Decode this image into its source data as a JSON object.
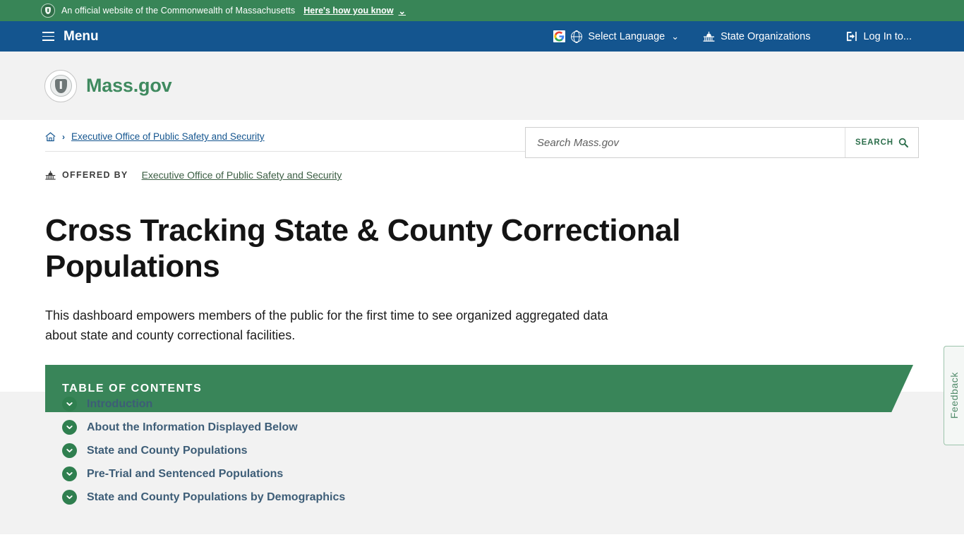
{
  "official_bar": {
    "seal_icon": "mass-seal-icon",
    "text": "An official website of the Commonwealth of Massachusetts",
    "how_you_know_label": "Here's how you know",
    "chevron": "⌄",
    "bg_color": "#388557"
  },
  "utility_nav": {
    "menu_label": "Menu",
    "menu_icon": "hamburger-icon",
    "language": {
      "google_icon": "google-g-icon",
      "globe_icon": "globe-icon",
      "label": "Select Language",
      "caret": "⌄"
    },
    "state_orgs": {
      "icon": "capitol-building-icon",
      "label": "State Organizations"
    },
    "login": {
      "icon": "login-arrow-icon",
      "label": "Log In to..."
    },
    "bg_color": "#14558f"
  },
  "header": {
    "logo_icon": "mass-gov-seal-icon",
    "brand_name": "Mass.gov",
    "brand_color": "#3f8a5f",
    "search": {
      "placeholder": "Search Mass.gov",
      "value": "",
      "button_label": "SEARCH",
      "button_icon": "search-icon"
    }
  },
  "breadcrumb": {
    "home_icon": "home-icon",
    "separator": "›",
    "items": [
      {
        "label": "Executive Office of Public Safety and Security"
      }
    ]
  },
  "offered_by": {
    "icon": "capitol-building-icon",
    "label": "OFFERED BY",
    "organization": "Executive Office of Public Safety and Security"
  },
  "page": {
    "title": "Cross Tracking State & County Correctional Populations",
    "intro": "This dashboard empowers members of the public for the first time to see organized aggregated data about state and county correctional facilities."
  },
  "table_of_contents": {
    "banner_label": "TABLE OF CONTENTS",
    "banner_color": "#398559",
    "items": [
      {
        "label": "Introduction",
        "icon": "chevron-down-circle-icon"
      },
      {
        "label": "About the Information Displayed Below",
        "icon": "chevron-down-circle-icon"
      },
      {
        "label": "State and County Populations",
        "icon": "chevron-down-circle-icon"
      },
      {
        "label": "Pre-Trial and Sentenced Populations",
        "icon": "chevron-down-circle-icon"
      },
      {
        "label": "State and County Populations by Demographics",
        "icon": "chevron-down-circle-icon"
      }
    ]
  },
  "feedback": {
    "label": "Feedback",
    "border_color": "#9dc4ac"
  }
}
